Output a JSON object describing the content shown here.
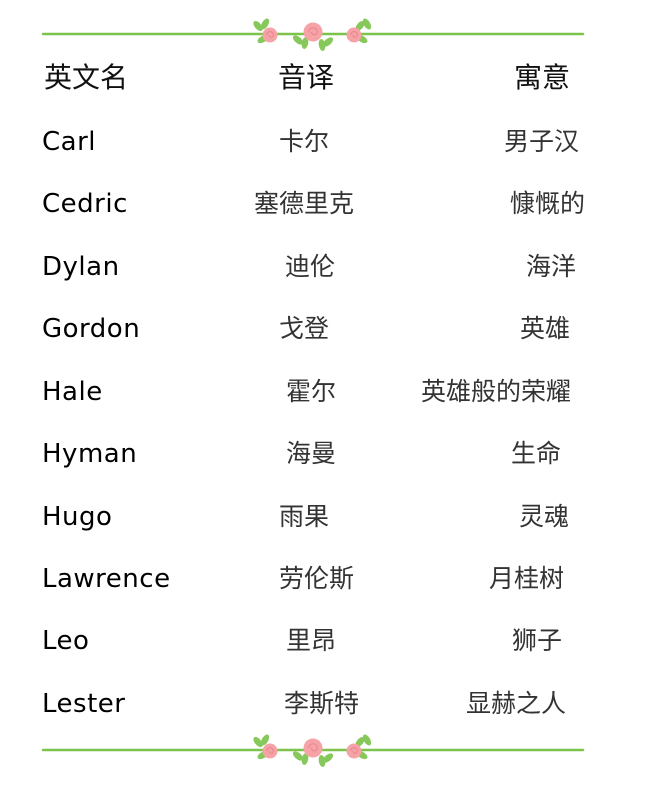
{
  "header": {
    "col_english": "英文名",
    "col_transliteration": "音译",
    "col_meaning": "寓意"
  },
  "names": [
    {
      "english": "Carl",
      "transliteration": "卡尔",
      "meaning": "男子汉"
    },
    {
      "english": "Cedric",
      "transliteration": "塞德里克",
      "meaning": "慷慨的"
    },
    {
      "english": "Dylan",
      "transliteration": "迪伦",
      "meaning": "海洋"
    },
    {
      "english": "Gordon",
      "transliteration": "戈登",
      "meaning": "英雄"
    },
    {
      "english": "Hale",
      "transliteration": "霍尔",
      "meaning": "英雄般的荣耀"
    },
    {
      "english": "Hyman",
      "transliteration": "海曼",
      "meaning": "生命"
    },
    {
      "english": "Hugo",
      "transliteration": "雨果",
      "meaning": "灵魂"
    },
    {
      "english": "Lawrence",
      "transliteration": "劳伦斯",
      "meaning": "月桂树"
    },
    {
      "english": "Leo",
      "transliteration": "里昂",
      "meaning": "狮子"
    },
    {
      "english": "Lester",
      "transliteration": "李斯特",
      "meaning": "显赫之人"
    }
  ],
  "decoration": {
    "vine_color": "#7dc24b",
    "leaf_color": "#86c85a",
    "rose_color": "#f6a3a8",
    "rose_dark": "#e9838c"
  }
}
